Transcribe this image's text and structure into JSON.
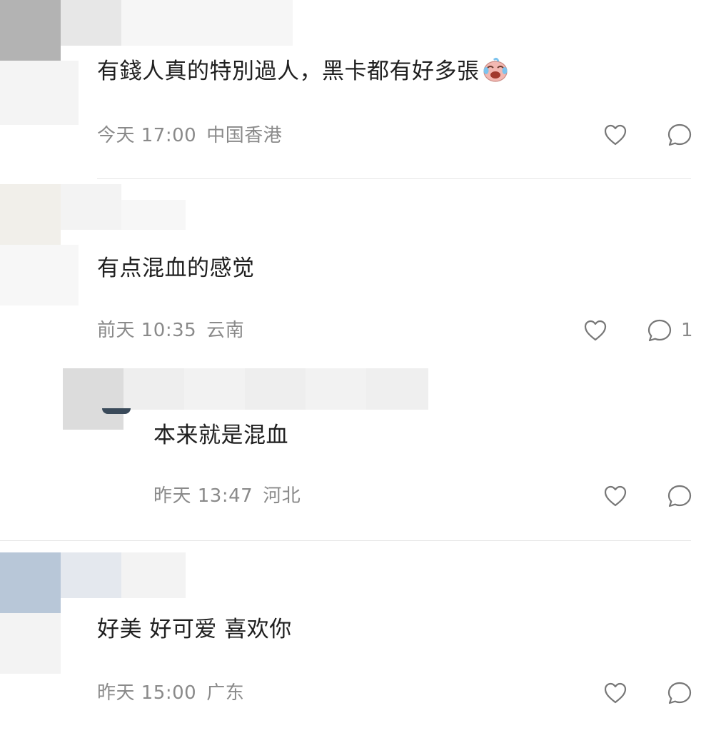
{
  "comments": [
    {
      "text": "有錢人真的特別過人，黑卡都有好多張",
      "emoji": "crying-laughing-emoji",
      "time": "今天 17:00",
      "location": "中国香港",
      "replies": ""
    },
    {
      "text": "有点混血的感觉",
      "time": "前天 10:35",
      "location": "云南",
      "replies": "1",
      "reply": {
        "text": "本来就是混血",
        "time": "昨天 13:47",
        "location": "河北"
      }
    },
    {
      "text": "好美 好可爱 喜欢你",
      "time": "昨天 15:00",
      "location": "广东",
      "replies": ""
    }
  ],
  "icons": {
    "like": "heart-outline-icon",
    "reply": "speech-bubble-icon"
  },
  "colors": {
    "text": "#202020",
    "meta": "#8a8a8a",
    "divider": "#e6e6e6",
    "icon": "#777777"
  }
}
